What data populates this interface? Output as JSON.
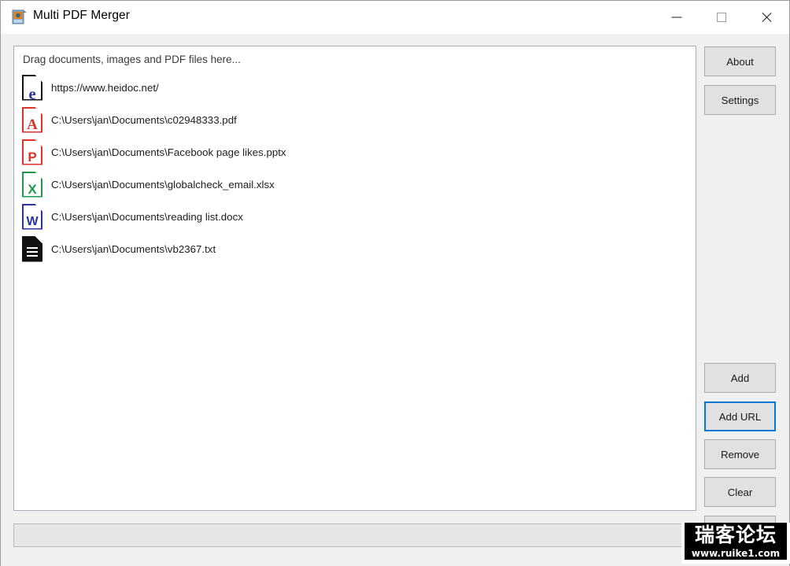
{
  "window": {
    "title": "Multi PDF Merger",
    "icon": "app-picture-icon",
    "controls": {
      "minimize": "minimize-icon",
      "maximize": "maximize-icon",
      "close": "close-icon"
    }
  },
  "file_list": {
    "drop_hint": "Drag documents, images and PDF files here...",
    "items": [
      {
        "icon": "edge-browser-file-icon",
        "glyph": "e",
        "path": "https://www.heidoc.net/"
      },
      {
        "icon": "pdf-file-icon",
        "glyph": "A",
        "path": "C:\\Users\\jan\\Documents\\c02948333.pdf"
      },
      {
        "icon": "powerpoint-file-icon",
        "glyph": "P",
        "path": "C:\\Users\\jan\\Documents\\Facebook page likes.pptx"
      },
      {
        "icon": "excel-file-icon",
        "glyph": "X",
        "path": "C:\\Users\\jan\\Documents\\globalcheck_email.xlsx"
      },
      {
        "icon": "word-file-icon",
        "glyph": "W",
        "path": "C:\\Users\\jan\\Documents\\reading list.docx"
      },
      {
        "icon": "text-file-icon",
        "glyph": "",
        "path": "C:\\Users\\jan\\Documents\\vb2367.txt"
      }
    ]
  },
  "buttons": {
    "about": "About",
    "settings": "Settings",
    "add": "Add",
    "add_url": "Add URL",
    "remove": "Remove",
    "clear": "Clear",
    "merge": ""
  },
  "status_bar": {
    "text": ""
  },
  "watermark": {
    "main": "瑞客论坛",
    "sub": "www.ruike1.com"
  },
  "colors": {
    "focus_border": "#0078d7",
    "window_background": "#f0f0f0",
    "button_face": "#e1e1e1",
    "pdf_red": "#d9332c",
    "ppt_red": "#e0342b",
    "excel_green": "#1d9a4c",
    "word_blue": "#2b33a0",
    "edge_blue": "#2b3a96",
    "text_black": "#111111"
  }
}
